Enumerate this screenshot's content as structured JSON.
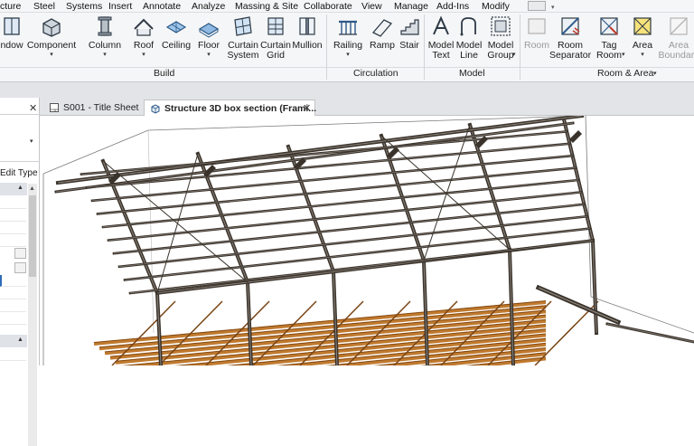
{
  "menu": [
    "cture",
    "Steel",
    "Systems",
    "Insert",
    "Annotate",
    "Analyze",
    "Massing & Site",
    "Collaborate",
    "View",
    "Manage",
    "Add-Ins",
    "Modify"
  ],
  "ribbon": {
    "build": {
      "label": "Build",
      "buttons": [
        {
          "label": "ndow",
          "icon": "window-icon"
        },
        {
          "label": "Component",
          "icon": "component-icon",
          "dropdown": true
        },
        {
          "label": "Column",
          "icon": "column-icon",
          "dropdown": true
        },
        {
          "label": "Roof",
          "icon": "roof-icon",
          "dropdown": true
        },
        {
          "label": "Ceiling",
          "icon": "ceiling-icon"
        },
        {
          "label": "Floor",
          "icon": "floor-icon",
          "dropdown": true
        },
        {
          "label": "Curtain System",
          "line1": "Curtain",
          "line2": "System",
          "icon": "curtain-system-icon"
        },
        {
          "label": "Curtain Grid",
          "line1": "Curtain",
          "line2": "Grid",
          "icon": "curtain-grid-icon"
        },
        {
          "label": "Mullion",
          "icon": "mullion-icon"
        }
      ]
    },
    "circulation": {
      "label": "Circulation",
      "buttons": [
        {
          "label": "Railing",
          "icon": "railing-icon",
          "dropdown": true
        },
        {
          "label": "Ramp",
          "icon": "ramp-icon"
        },
        {
          "label": "Stair",
          "icon": "stair-icon"
        }
      ]
    },
    "model": {
      "label": "Model",
      "buttons": [
        {
          "line1": "Model",
          "line2": "Text",
          "icon": "model-text-icon"
        },
        {
          "line1": "Model",
          "line2": "Line",
          "icon": "model-line-icon"
        },
        {
          "line1": "Model",
          "line2": "Group",
          "icon": "model-group-icon",
          "dropdown": true
        }
      ]
    },
    "room_area": {
      "label": "Room & Area",
      "buttons": [
        {
          "line1": "Room",
          "line2": "",
          "icon": "room-icon",
          "disabled": true
        },
        {
          "line1": "Room",
          "line2": "Separator",
          "icon": "room-separator-icon"
        },
        {
          "line1": "Tag",
          "line2": "Room",
          "icon": "tag-room-icon",
          "dropdown": true
        },
        {
          "line1": "Area",
          "line2": "",
          "icon": "area-icon",
          "dropdown": true
        },
        {
          "line1": "Area",
          "line2": "Boundary",
          "icon": "area-boundary-icon",
          "disabled": true
        }
      ]
    }
  },
  "palette": {
    "edit_type": "Edit Type",
    "close": "✕"
  },
  "tabs": [
    {
      "label": "S001 - Title Sheet",
      "icon": "sheet-icon",
      "active": false
    },
    {
      "label": "Structure 3D box section (Frami...",
      "icon": "3d-view-icon",
      "active": true
    }
  ],
  "colors": {
    "steel": "#3a332c",
    "steel_light": "#8c847a",
    "timber": "#c07a2e",
    "timber_dark": "#7a4414",
    "ribbon_bg": "#f5f6f7",
    "tab_strip": "#e3e4e7",
    "section_box": "#7a7a7a"
  }
}
